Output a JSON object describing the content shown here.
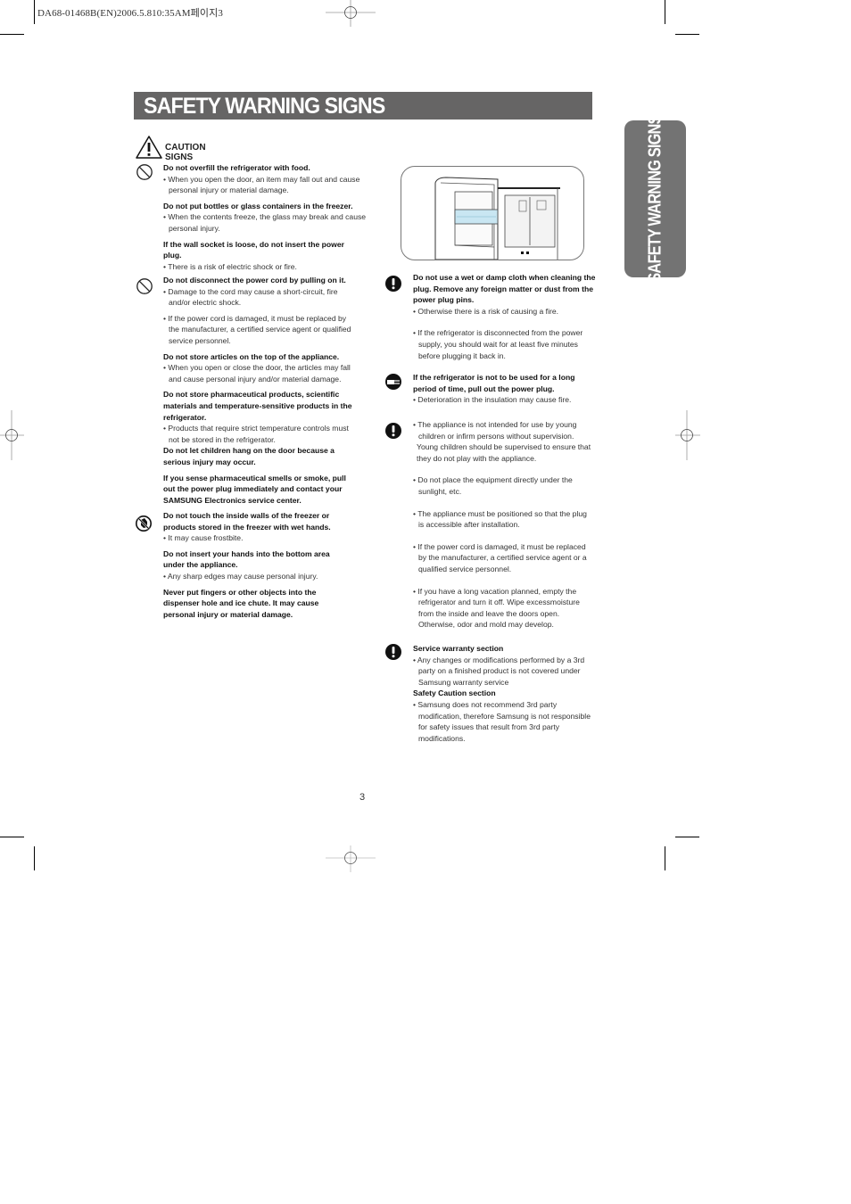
{
  "print_header": "DA68-01468B(EN)2006.5.810:35AM페이지3",
  "title": "SAFETY WARNING SIGNS",
  "side_tab": "SAFETY WARNING SIGNS",
  "caution_heading": "CAUTION SIGNS",
  "page_number": "3",
  "left_column": {
    "group1": {
      "icon": "prohibition-icon",
      "items": [
        {
          "heading": "Do not overfill the refrigerator with food.",
          "bullet": "• When you open the door, an item may fall out and cause personal injury or material damage."
        },
        {
          "heading": "Do not put bottles or glass containers in the freezer.",
          "bullet": "• When the contents freeze, the glass may break and cause personal injury."
        },
        {
          "heading": "If the wall socket is loose, do not insert the power plug.",
          "bullet": "• There is a risk of electric shock or fire."
        }
      ]
    },
    "group2": {
      "icon": "prohibition-icon",
      "heading1": "Do not disconnect the power cord by pulling on it.",
      "bullet1a": "• Damage to the cord may cause a short-circuit, fire and/or electric shock.",
      "bullet1b": "• If the power cord is damaged, it must be replaced by the manufacturer, a certified service agent or qualified service personnel.",
      "heading2": "Do not store articles on the top of the appliance.",
      "bullet2": "• When you open or close the door, the articles may fall and cause personal injury and/or material damage.",
      "heading3": "Do not store pharmaceutical products, scientific materials and temperature-sensitive products in the refrigerator.",
      "bullet3": "• Products that require strict temperature controls must not be stored in the refrigerator.",
      "heading4": "Do not let children hang on the door because a serious injury may occur.",
      "heading5": "If you sense pharmaceutical smells or smoke, pull out the power plug immediately and contact your SAMSUNG Electronics service center."
    },
    "group3": {
      "icon": "no-wet-hands-icon",
      "heading1": "Do not touch the inside walls of the freezer or products stored in the freezer with wet hands.",
      "bullet1": "• It may cause frostbite.",
      "heading2": "Do not insert your hands into the bottom area under the appliance.",
      "bullet2": "• Any sharp edges may cause personal injury.",
      "heading3": "Never put fingers or other objects into the dispenser hole and ice chute.  It may cause personal injury or material damage."
    }
  },
  "right_column": {
    "group1": {
      "icon": "mandatory-exclamation-icon",
      "heading": "Do not use a wet or damp cloth when cleaning the plug. Remove any foreign matter or dust from the power plug pins.",
      "bullet1": "• Otherwise there is a risk of causing a fire.",
      "bullet2": "• If the refrigerator is disconnected from the power supply, you should wait for at least five minutes before plugging it back in."
    },
    "group2": {
      "icon": "unplug-icon",
      "heading": "If the refrigerator  is not to be used for a long period of time, pull out the power plug.",
      "bullet": "• Deterioration in the insulation may cause fire."
    },
    "group3": {
      "icon": "mandatory-exclamation-icon",
      "bullet1": "• The appliance is not intended for use by young children or infirm persons without supervision.",
      "bullet1_cont": "Young children should be supervised to ensure that they do not play with the appliance.",
      "bullet2": "• Do not place the equipment directly under the sunlight, etc.",
      "bullet3": "• The appliance must be positioned so that the plug is accessible after installation.",
      "bullet4": "• If the power cord is damaged, it must be replaced by the manufacturer, a certified service agent or a qualified service personnel.",
      "bullet5": "• If you have a long vacation planned, empty the refrigerator and turn it off. Wipe excessmoisture from the inside and leave the doors open. Otherwise, odor and mold may develop."
    },
    "group4": {
      "icon": "mandatory-exclamation-icon",
      "heading1": "Service warranty section",
      "bullet1": "• Any changes or modifications performed by a 3rd party on a finished product is not covered under Samsung warranty service",
      "heading2": "Safety Caution section",
      "bullet2": "• Samsung does not recommend 3rd party modification, therefore Samsung is not responsible for safety issues that result from 3rd party modifications."
    }
  },
  "figure": {
    "description": "refrigerator-door-illustration"
  }
}
